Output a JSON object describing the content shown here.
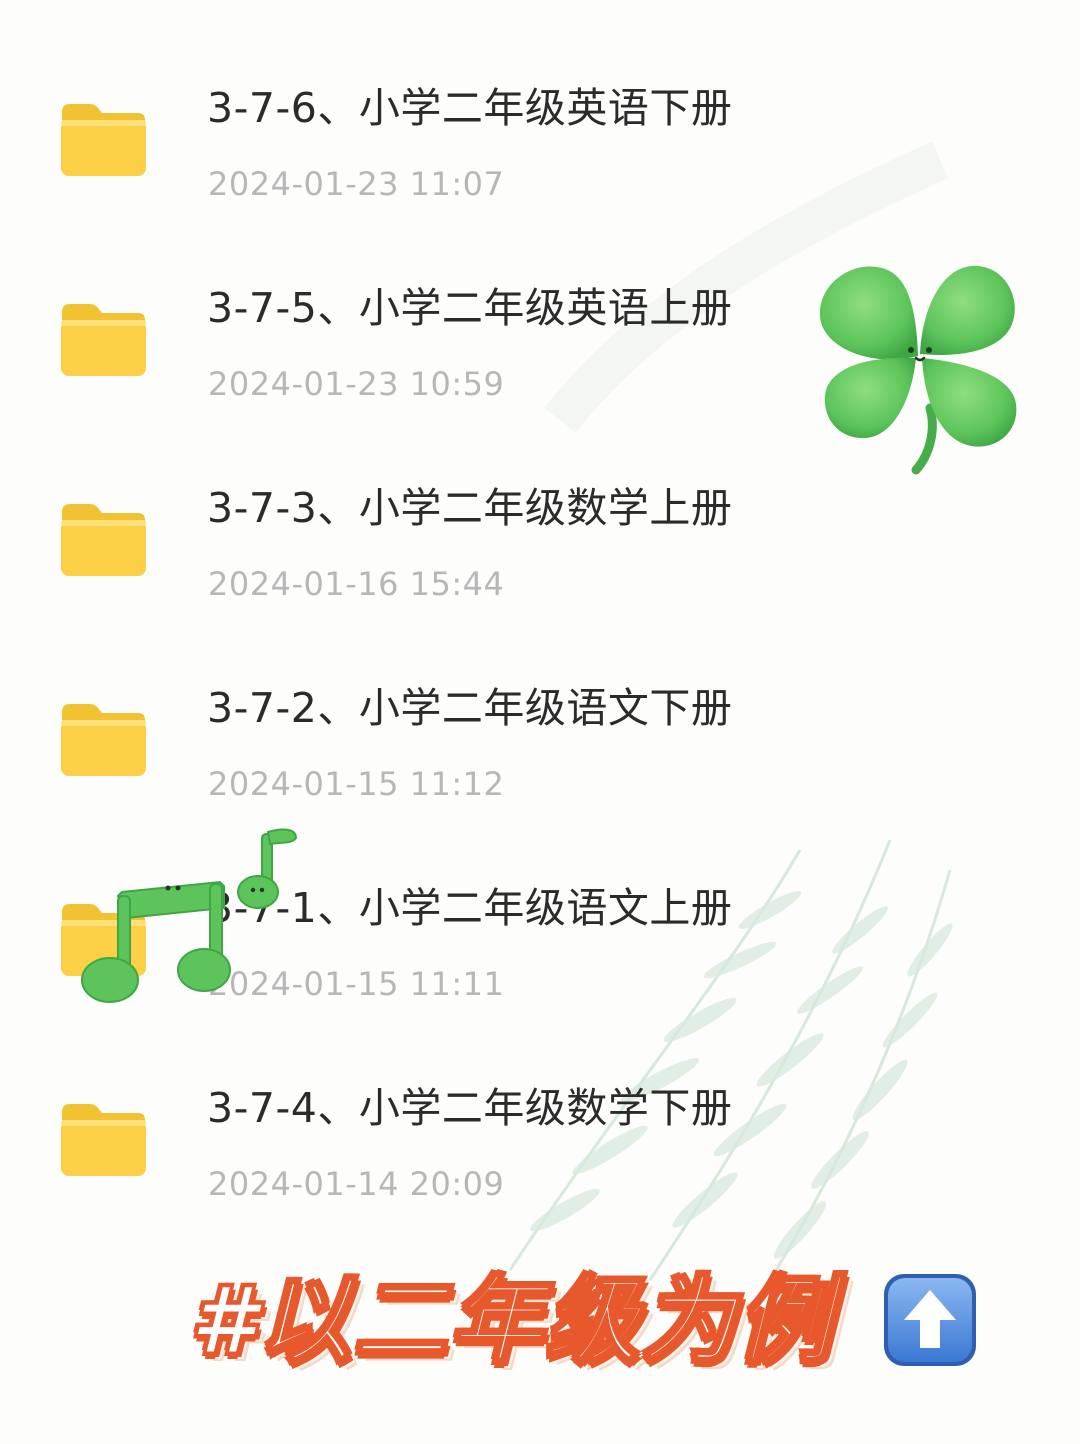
{
  "files": [
    {
      "name": "3-7-6、小学二年级英语下册",
      "date": "2024-01-23 11:07",
      "icon": "folder-icon"
    },
    {
      "name": "3-7-5、小学二年级英语上册",
      "date": "2024-01-23 10:59",
      "icon": "folder-icon"
    },
    {
      "name": "3-7-3、小学二年级数学上册",
      "date": "2024-01-16 15:44",
      "icon": "folder-icon"
    },
    {
      "name": "3-7-2、小学二年级语文下册",
      "date": "2024-01-15 11:12",
      "icon": "folder-icon"
    },
    {
      "name": "3-7-1、小学二年级语文上册",
      "date": "2024-01-15 11:11",
      "icon": "folder-icon"
    },
    {
      "name": "3-7-4、小学二年级数学下册",
      "date": "2024-01-14 20:09",
      "icon": "folder-icon"
    }
  ],
  "banner": {
    "text": "#以二年级为例",
    "icon": "arrow-up-icon"
  },
  "stickers": [
    "clover-sticker",
    "music-notes-sticker"
  ],
  "colors": {
    "folder": "#fbd046",
    "folder_tab": "#f3c232",
    "title_text": "#2b2b2b",
    "date_text": "#b7b7b7",
    "banner_outline": "#e8582d",
    "sticker_green": "#5cc45a"
  }
}
